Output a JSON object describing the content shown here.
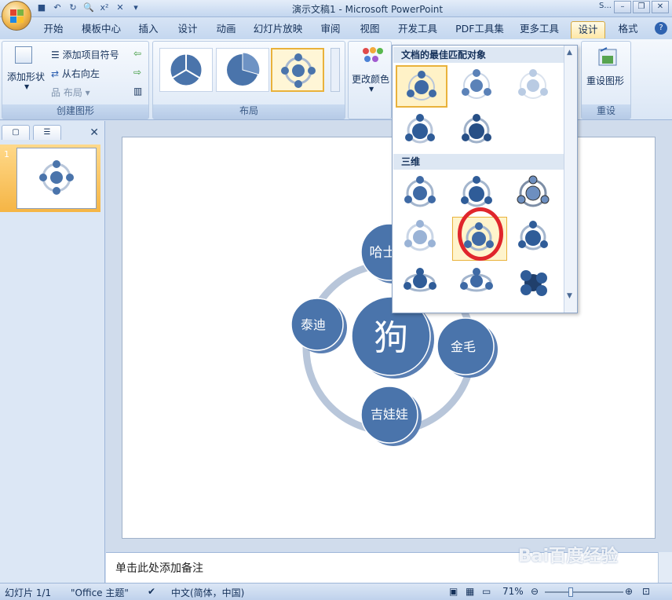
{
  "title_bar": {
    "title": "演示文稿1 - Microsoft PowerPoint",
    "truncated_right": "S...",
    "qat_icons": [
      "save-icon",
      "undo-icon",
      "redo-icon",
      "print-preview-icon",
      "format-icon",
      "close-format-icon",
      "dropdown-icon"
    ],
    "window_buttons": [
      "minimize",
      "restore",
      "close"
    ]
  },
  "tabs": [
    "开始",
    "模板中心",
    "插入",
    "设计",
    "动画",
    "幻灯片放映",
    "审阅",
    "视图",
    "开发工具",
    "PDF工具集",
    "更多工具",
    "设计",
    "格式"
  ],
  "active_tab_index": 11,
  "ribbon": {
    "create_graphic": {
      "add_shape": "添加形状",
      "add_bullet": "添加项目符号",
      "right_to_left": "从右向左",
      "layout": "布局",
      "label": "创建图形"
    },
    "layout_group": {
      "label": "布局"
    },
    "change_colors": "更改颜色",
    "reset": {
      "reset_graphic": "重设图形",
      "label": "重设"
    }
  },
  "gallery": {
    "section1": "文档的最佳匹配对象",
    "section2": "三维"
  },
  "left_panel": {
    "slide_number": "1"
  },
  "slide": {
    "center": "狗",
    "nodes": {
      "top": "哈士奇",
      "left": "泰迪",
      "right": "金毛",
      "bottom": "吉娃娃"
    }
  },
  "notes_placeholder": "单击此处添加备注",
  "status": {
    "slide_info": "幻灯片 1/1",
    "theme": "\"Office 主题\"",
    "language": "中文(简体，中国)",
    "zoom": "71%"
  },
  "watermark": "Bai百度经验",
  "colors": {
    "node_blue": "#4a74ab",
    "ring": "#b8c6da",
    "highlight": "#e9b23b",
    "red_mark": "#e0262c"
  }
}
